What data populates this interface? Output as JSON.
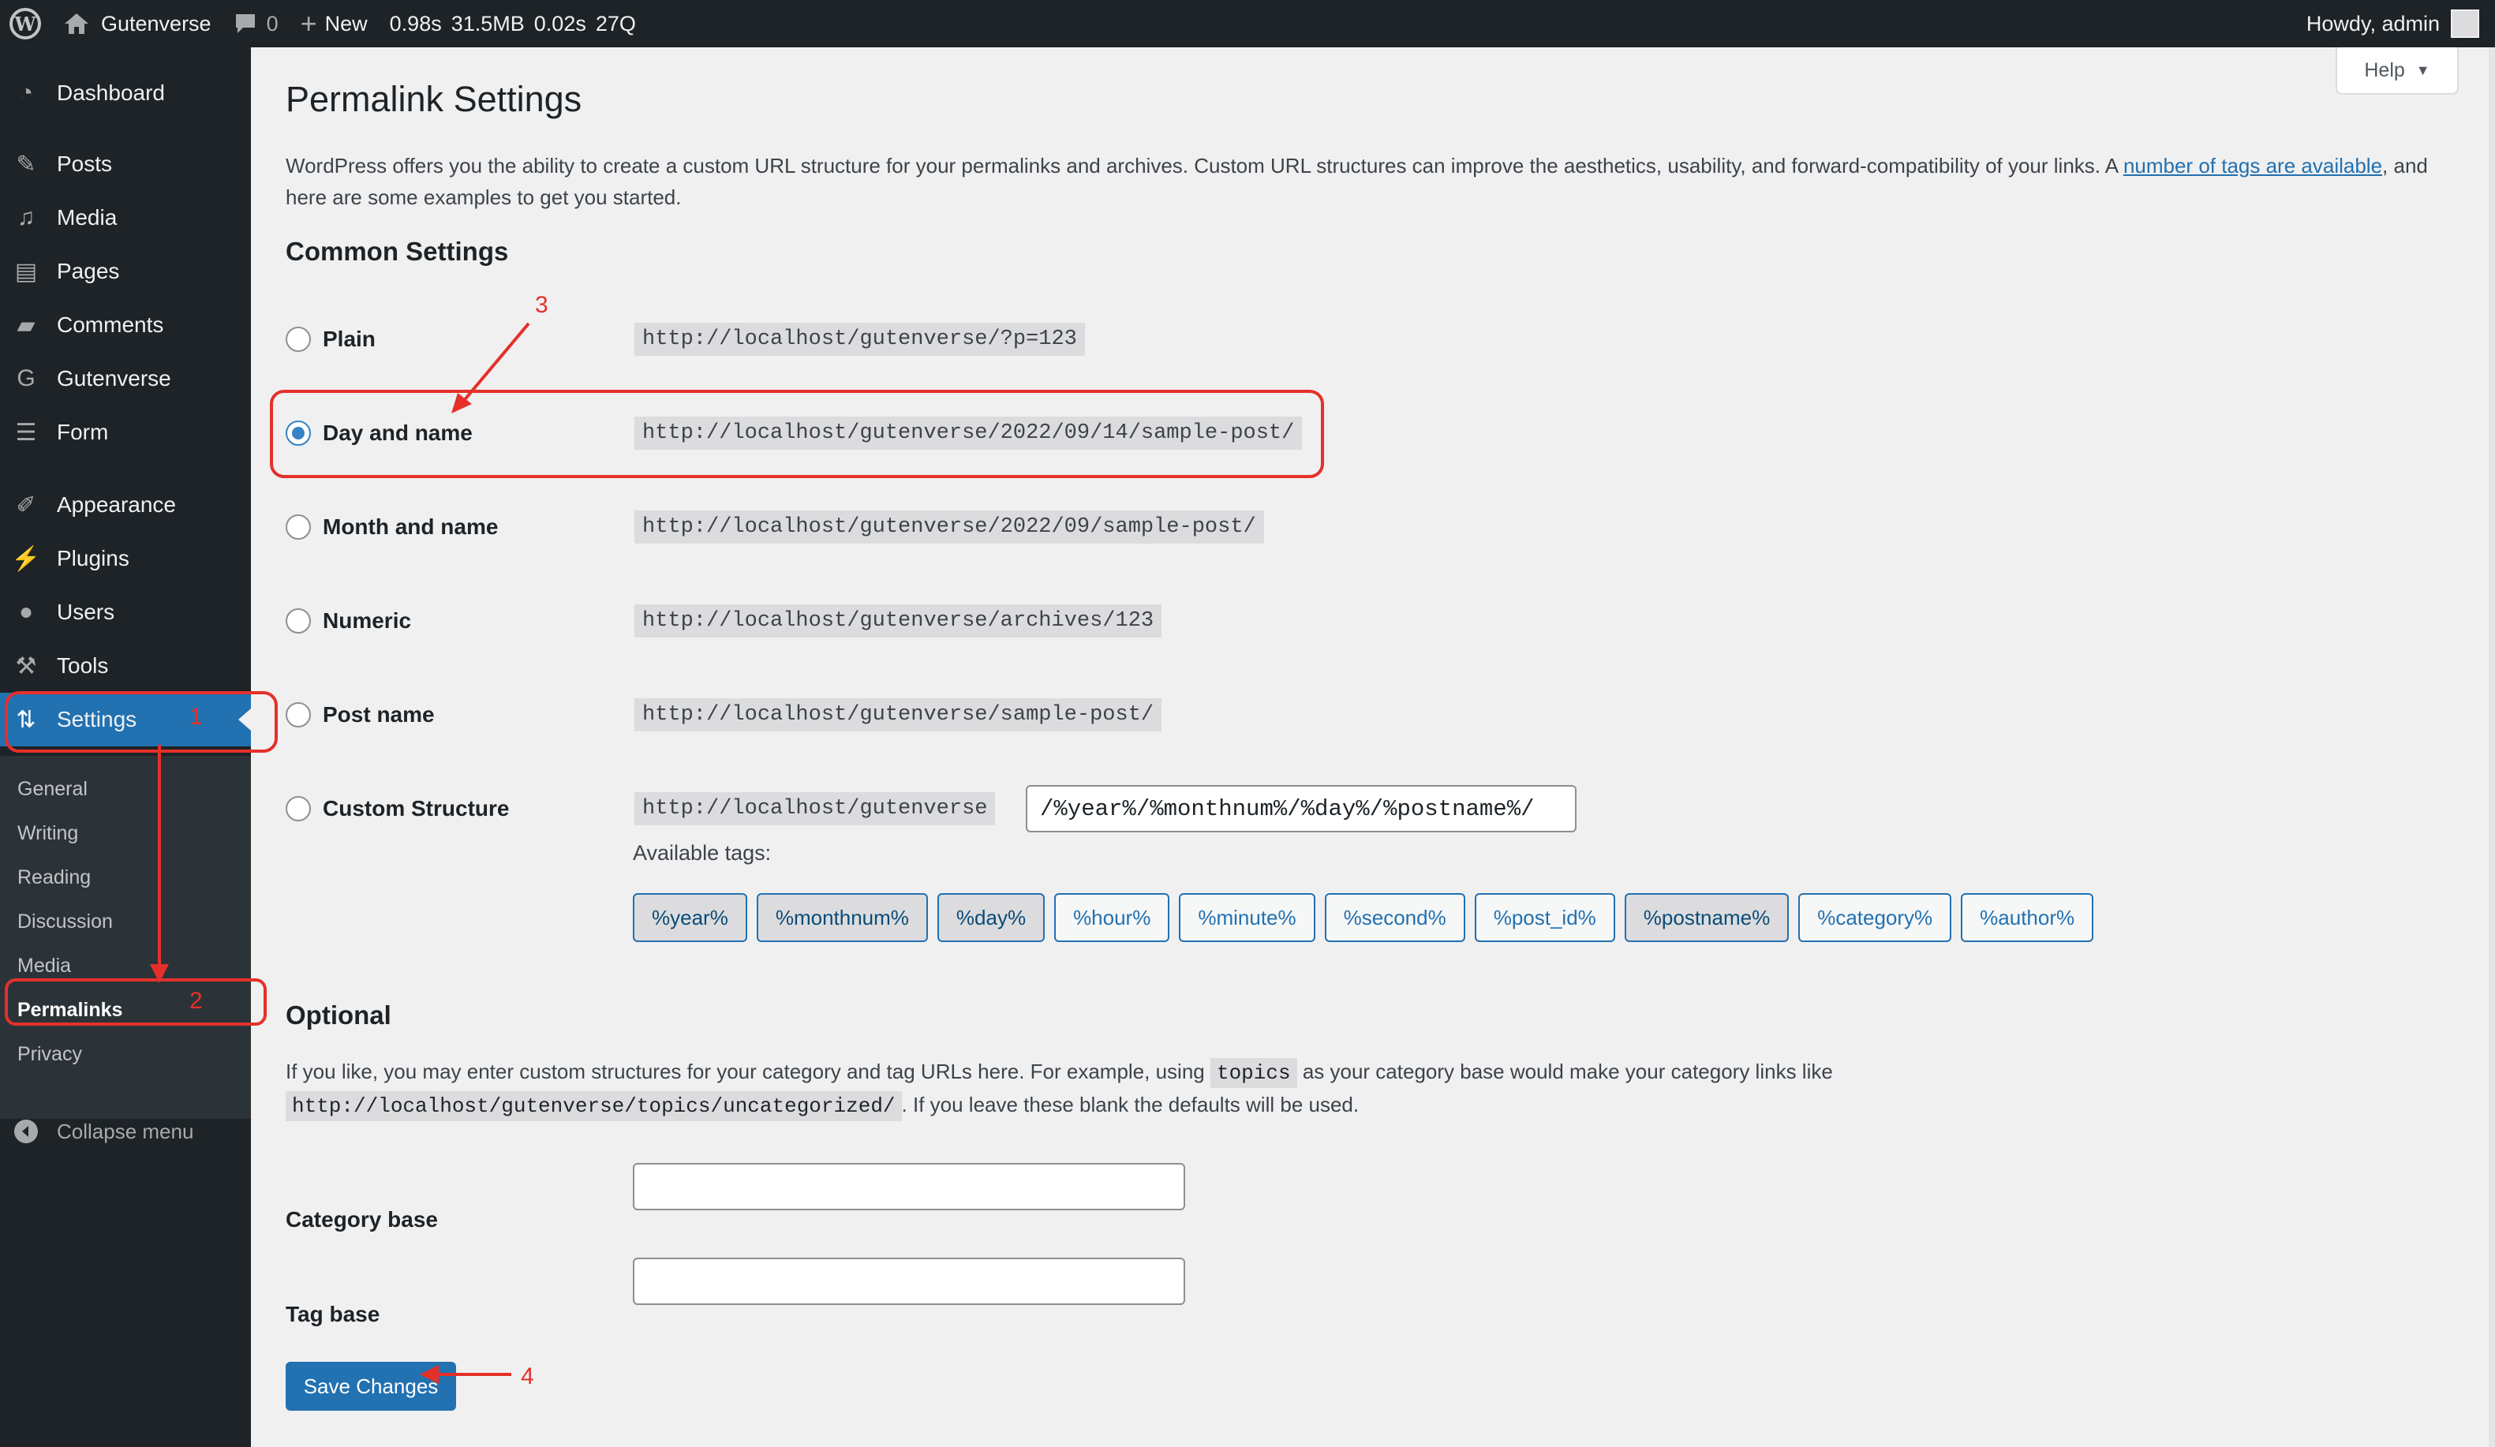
{
  "adminbar": {
    "site_name": "Gutenverse",
    "comments_count": "0",
    "new_label": "New",
    "perf_time": "0.98s",
    "perf_memory": "31.5MB",
    "perf_query_time": "0.02s",
    "perf_queries": "27Q",
    "howdy": "Howdy, admin"
  },
  "sidebar": {
    "items": [
      {
        "label": "Dashboard",
        "icon": "dashboard-icon"
      },
      {
        "label": "Posts",
        "icon": "pin-icon"
      },
      {
        "label": "Media",
        "icon": "media-icon"
      },
      {
        "label": "Pages",
        "icon": "pages-icon"
      },
      {
        "label": "Comments",
        "icon": "comment-icon"
      },
      {
        "label": "Gutenverse",
        "icon": "gutenverse-icon"
      },
      {
        "label": "Form",
        "icon": "form-icon"
      },
      {
        "label": "Appearance",
        "icon": "brush-icon"
      },
      {
        "label": "Plugins",
        "icon": "plug-icon"
      },
      {
        "label": "Users",
        "icon": "user-icon"
      },
      {
        "label": "Tools",
        "icon": "wrench-icon"
      },
      {
        "label": "Settings",
        "icon": "settings-icon"
      }
    ],
    "submenu": [
      "General",
      "Writing",
      "Reading",
      "Discussion",
      "Media",
      "Permalinks",
      "Privacy"
    ],
    "collapse_label": "Collapse menu"
  },
  "help_label": "Help",
  "page_title": "Permalink Settings",
  "intro": {
    "text_before": "WordPress offers you the ability to create a custom URL structure for your permalinks and archives. Custom URL structures can improve the aesthetics, usability, and forward-compatibility of your links. A ",
    "link_text": "number of tags are available",
    "text_after": ", and here are some examples to get you started."
  },
  "common_settings_title": "Common Settings",
  "permalink_options": [
    {
      "label": "Plain",
      "example": "http://localhost/gutenverse/?p=123",
      "checked": false
    },
    {
      "label": "Day and name",
      "example": "http://localhost/gutenverse/2022/09/14/sample-post/",
      "checked": true
    },
    {
      "label": "Month and name",
      "example": "http://localhost/gutenverse/2022/09/sample-post/",
      "checked": false
    },
    {
      "label": "Numeric",
      "example": "http://localhost/gutenverse/archives/123",
      "checked": false
    },
    {
      "label": "Post name",
      "example": "http://localhost/gutenverse/sample-post/",
      "checked": false
    }
  ],
  "custom_structure": {
    "label": "Custom Structure",
    "base": "http://localhost/gutenverse",
    "value": "/%year%/%monthnum%/%day%/%postname%/",
    "available_tags_label": "Available tags:",
    "tags": [
      {
        "label": "%year%",
        "active": true
      },
      {
        "label": "%monthnum%",
        "active": true
      },
      {
        "label": "%day%",
        "active": true
      },
      {
        "label": "%hour%",
        "active": false
      },
      {
        "label": "%minute%",
        "active": false
      },
      {
        "label": "%second%",
        "active": false
      },
      {
        "label": "%post_id%",
        "active": false
      },
      {
        "label": "%postname%",
        "active": true
      },
      {
        "label": "%category%",
        "active": false
      },
      {
        "label": "%author%",
        "active": false
      }
    ]
  },
  "optional": {
    "title": "Optional",
    "text_1": "If you like, you may enter custom structures for your category and tag URLs here. For example, using ",
    "code_1": "topics",
    "text_2": " as your category base would make your category links like ",
    "code_2": "http://localhost/gutenverse/topics/uncategorized/",
    "text_3": ". If you leave these blank the defaults will be used.",
    "category_base_label": "Category base",
    "category_base_value": "",
    "tag_base_label": "Tag base",
    "tag_base_value": ""
  },
  "save_label": "Save Changes",
  "annotations": [
    "1",
    "2",
    "3",
    "4"
  ],
  "colors": {
    "accent": "#2271b1",
    "annotation": "#e5302a",
    "sidebar": "#1d2327"
  }
}
